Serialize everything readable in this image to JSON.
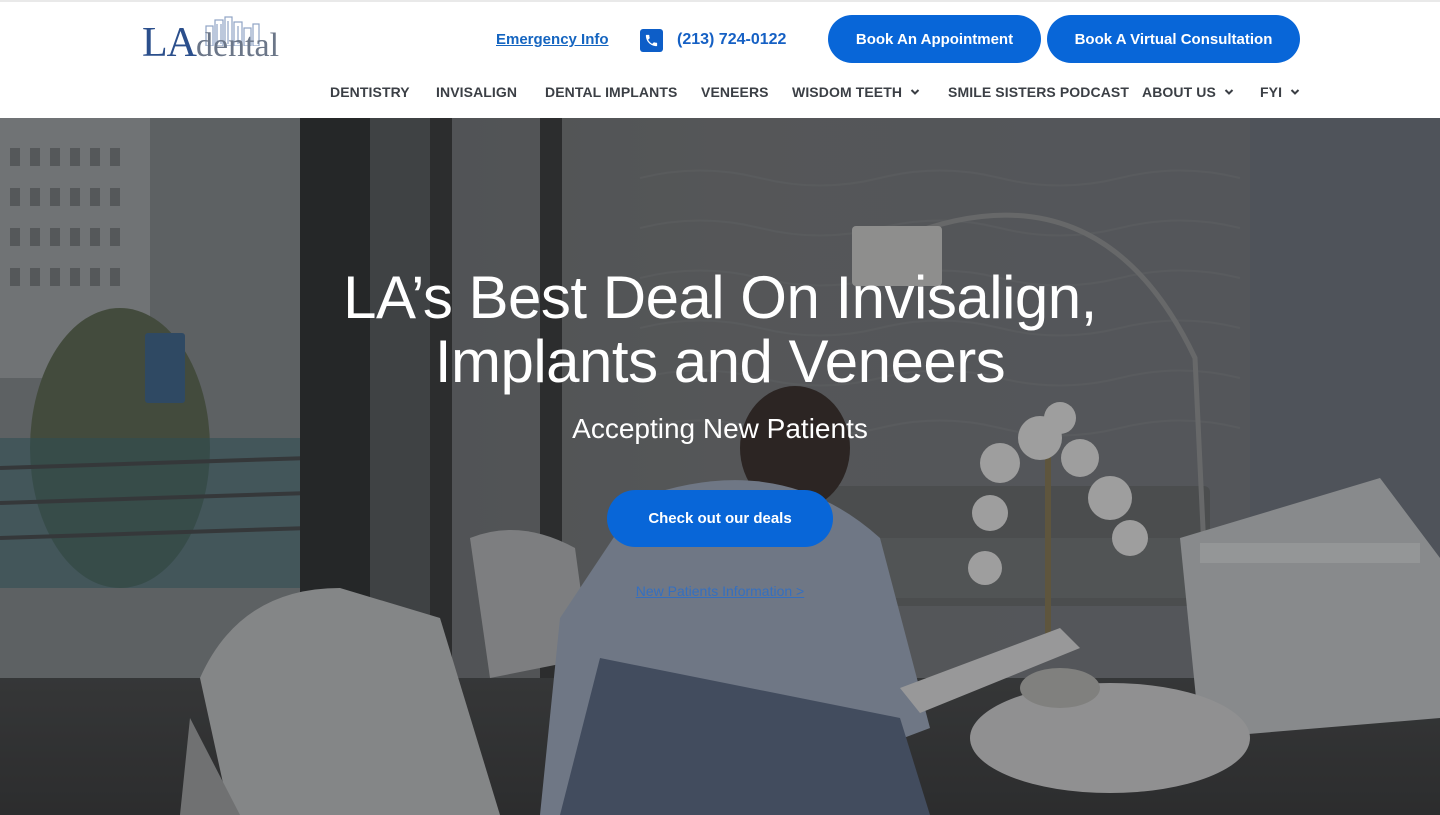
{
  "header": {
    "logo": {
      "primary": "LA",
      "secondary": "dental"
    },
    "emergency_link": "Emergency Info",
    "phone": "(213) 724-0122",
    "book_appointment": "Book An Appointment",
    "book_virtual": "Book A Virtual Consultation"
  },
  "nav": {
    "items": [
      {
        "label": "DENTISTRY",
        "has_dropdown": false
      },
      {
        "label": "INVISALIGN",
        "has_dropdown": false
      },
      {
        "label": "DENTAL IMPLANTS",
        "has_dropdown": false
      },
      {
        "label": "VENEERS",
        "has_dropdown": false
      },
      {
        "label": "WISDOM TEETH",
        "has_dropdown": true
      },
      {
        "label": "SMILE SISTERS PODCAST",
        "has_dropdown": false
      },
      {
        "label": "ABOUT US",
        "has_dropdown": true
      },
      {
        "label": "FYI",
        "has_dropdown": true
      }
    ]
  },
  "hero": {
    "title_line1": "LA’s Best Deal On Invisalign,",
    "title_line2": "Implants and Veneers",
    "subtitle": "Accepting New Patients",
    "cta": "Check out our deals",
    "secondary_link": "New Patients Information >"
  },
  "icons": {
    "phone": "phone-icon",
    "dropdown": "chevron-down-icon",
    "logo_mark": "city-skyline-icon"
  },
  "colors": {
    "accent": "#0866d8",
    "link": "#1565c0",
    "nav_text": "#3b3f45",
    "logo_blue": "#2b4f8c",
    "logo_gray": "#6b7688"
  }
}
